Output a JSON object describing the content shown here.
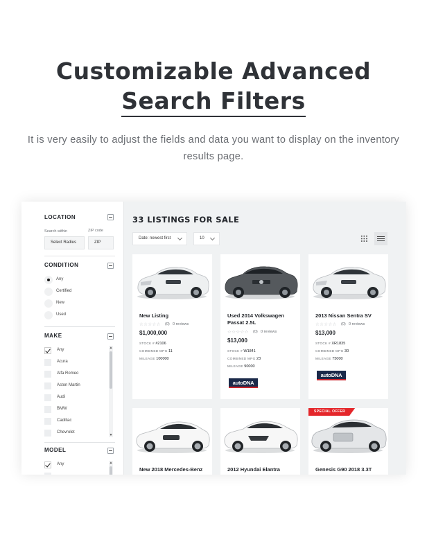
{
  "hero": {
    "title_line1": "Customizable Advanced",
    "title_line2": "Search Filters",
    "subtitle": "It is very easily to adjust the fields and data you want to display on the inventory results page."
  },
  "sidebar": {
    "location": {
      "title": "LOCATION",
      "search_within_label": "Search within",
      "radius_value": "Select Radius",
      "zip_label": "ZIP code",
      "zip_placeholder": "ZIP"
    },
    "condition": {
      "title": "CONDITION",
      "options": [
        {
          "label": "Any",
          "selected": true
        },
        {
          "label": "Certified",
          "selected": false
        },
        {
          "label": "New",
          "selected": false
        },
        {
          "label": "Used",
          "selected": false
        }
      ]
    },
    "make": {
      "title": "MAKE",
      "options": [
        {
          "label": "Any",
          "checked": true
        },
        {
          "label": "Acura",
          "checked": false
        },
        {
          "label": "Alfa Romeo",
          "checked": false
        },
        {
          "label": "Aston Martin",
          "checked": false
        },
        {
          "label": "Audi",
          "checked": false
        },
        {
          "label": "BMW",
          "checked": false
        },
        {
          "label": "Cadillac",
          "checked": false
        },
        {
          "label": "Chevrolet",
          "checked": false
        }
      ]
    },
    "model": {
      "title": "MODEL",
      "options": [
        {
          "label": "Any",
          "checked": true
        }
      ]
    }
  },
  "main": {
    "heading": "33 LISTINGS FOR SALE",
    "sort_value": "Date: newest first",
    "per_page_value": "10",
    "colors": {
      "accent_red": "#e4262a",
      "autodna_navy": "#1b2a4a"
    }
  },
  "listings": [
    {
      "name": "New Listing",
      "rating_count": "(0)",
      "reviews": "0 reviews",
      "price": "$1,000,000",
      "specs": [
        {
          "k": "STOCK #",
          "v": "#2106"
        },
        {
          "k": "COMBINED MPG",
          "v": "11"
        },
        {
          "k": "MILEAGE",
          "v": "100000"
        }
      ],
      "car_color": "#f3f4f5",
      "badge": "autoDNA",
      "show_badge": false
    },
    {
      "name": "Used 2014 Volkswagen Passat 2.5L",
      "rating_count": "(0)",
      "reviews": "0 reviews",
      "price": "$13,000",
      "specs": [
        {
          "k": "STOCK #",
          "v": "W1841"
        },
        {
          "k": "COMBINED MPG",
          "v": "23"
        },
        {
          "k": "MILEAGE",
          "v": "90000"
        }
      ],
      "car_color": "#5a5d60",
      "badge": "autoDNA",
      "show_badge": true
    },
    {
      "name": "2013 Nissan Sentra SV",
      "rating_count": "(0)",
      "reviews": "0 reviews",
      "price": "$13,000",
      "specs": [
        {
          "k": "STOCK #",
          "v": "XR1835"
        },
        {
          "k": "COMBINED MPG",
          "v": "30"
        },
        {
          "k": "MILEAGE",
          "v": "75000"
        }
      ],
      "car_color": "#f3f4f5",
      "badge": "autoDNA",
      "show_badge": true
    },
    {
      "name": "New 2018 Mercedes-Benz",
      "car_color": "#f6f6f6"
    },
    {
      "name": "2012 Hyundai Elantra",
      "car_color": "#f6f6f6"
    },
    {
      "name": "Genesis G90 2018 3.3T",
      "car_color": "#e9eaec",
      "special": "SPECIAL OFFER"
    }
  ]
}
